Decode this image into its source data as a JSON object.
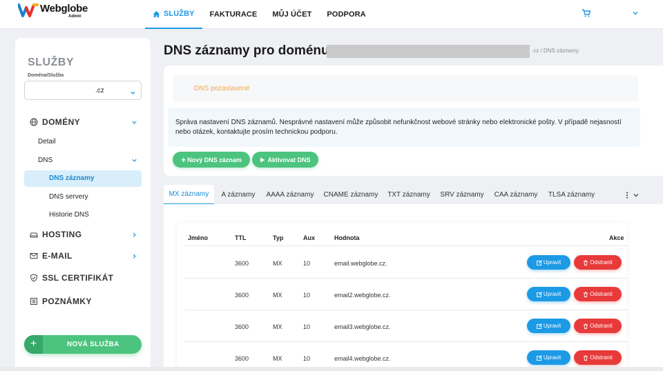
{
  "brand": {
    "name": "Webglobe",
    "sub": "Admin"
  },
  "topnav": [
    {
      "label": "SLUŽBY",
      "active": true
    },
    {
      "label": "FAKTURACE"
    },
    {
      "label": "MŮJ ÚČET"
    },
    {
      "label": "PODPORA"
    }
  ],
  "sidebar": {
    "title": "SLUŽBY",
    "subtitle": "Doména/Služba",
    "select_value": ".cz",
    "domains_label": "DOMÉNY",
    "detail": "Detail",
    "dns": "DNS",
    "dns_records": "DNS záznamy",
    "dns_servers": "DNS servery",
    "dns_history": "Historie DNS",
    "hosting": "HOSTING",
    "email": "E-MAIL",
    "ssl": "SSL CERTIFIKÁT",
    "notes": "POZNÁMKY",
    "new_service": "NOVÁ SLUŽBA"
  },
  "page": {
    "title": "DNS záznamy pro doménu",
    "breadcrumb": ".cz / DNS záznamy",
    "status": "DNS pozastavené",
    "info": "Správa nastavení DNS záznamů. Nesprávné nastavení může způsobit nefunkčnost webové stránky nebo elektronické pošty. V případě nejasností nebo otázek, kontaktujte prosím technickou podporu.",
    "btn_new": "Nový DNS záznam",
    "btn_activate": "Aktivovat DNS"
  },
  "tabs": [
    "MX záznamy",
    "A záznamy",
    "AAAA záznamy",
    "CNAME záznamy",
    "TXT záznamy",
    "SRV záznamy",
    "CAA záznamy",
    "TLSA záznamy"
  ],
  "table": {
    "headers": {
      "name": "Jméno",
      "ttl": "TTL",
      "type": "Typ",
      "aux": "Aux",
      "value": "Hodnota",
      "actions": "Akce"
    },
    "rows": [
      {
        "name": "",
        "ttl": "3600",
        "type": "MX",
        "aux": "10",
        "value": "email.webglobe.cz."
      },
      {
        "name": "",
        "ttl": "3600",
        "type": "MX",
        "aux": "10",
        "value": "email2.webglobe.cz."
      },
      {
        "name": "",
        "ttl": "3600",
        "type": "MX",
        "aux": "10",
        "value": "email3.webglobe.cz."
      },
      {
        "name": "",
        "ttl": "3600",
        "type": "MX",
        "aux": "10",
        "value": "email4.webglobe.cz."
      }
    ],
    "edit_label": "Upravit",
    "delete_label": "Odstranit"
  },
  "colors": {
    "accent": "#1d9ae6",
    "green": "#4cc47f",
    "red": "#e83a3a",
    "warning": "#f2a54a"
  }
}
